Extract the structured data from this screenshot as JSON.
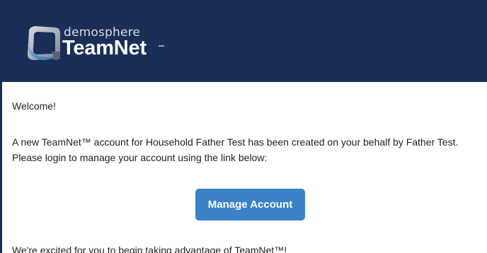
{
  "header": {
    "logo_subtitle": "demosphere",
    "logo_title": "TeamNet"
  },
  "email": {
    "greeting": "Welcome!",
    "intro": "A new TeamNet™ account for Household Father Test has been created on your behalf by Father Test. Please login to manage your account using the link below:",
    "button_label": "Manage Account",
    "closing": "We're excited for you to begin taking advantage of TeamNet™!"
  },
  "colors": {
    "header_bg": "#1a2e57",
    "button_bg": "#3b82c6",
    "logo_mark_dark": "#6d7686",
    "logo_mark_light": "#c4cad3",
    "logo_mark_accent": "#4a90c9"
  }
}
